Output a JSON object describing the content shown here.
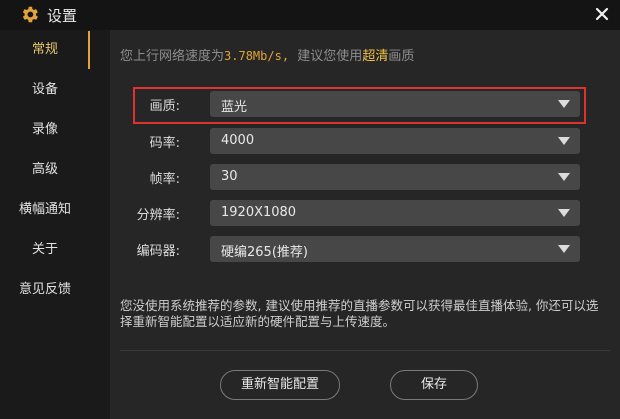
{
  "window": {
    "title": "设置",
    "title_icon": "gear-icon",
    "close_icon": "close-icon"
  },
  "sidebar": {
    "items": [
      {
        "label": "常规"
      },
      {
        "label": "设备"
      },
      {
        "label": "录像"
      },
      {
        "label": "高级"
      },
      {
        "label": "横幅通知"
      },
      {
        "label": "关于"
      },
      {
        "label": "意见反馈"
      }
    ],
    "active_index": 0
  },
  "tip": {
    "prefix": "您上行网络速度为",
    "speed": "3.78Mb/s,",
    "middle": "  建议您使用",
    "highlight": "超清",
    "suffix": "画质"
  },
  "settings": [
    {
      "label": "画质:",
      "value": "蓝光"
    },
    {
      "label": "码率:",
      "value": "4000"
    },
    {
      "label": "帧率:",
      "value": "30"
    },
    {
      "label": "分辨率:",
      "value": "1920X1080"
    },
    {
      "label": "编码器:",
      "value": "硬编265(推荐)"
    }
  ],
  "hint": "您没使用系统推荐的参数, 建议使用推荐的直播参数可以获得最佳直播体验, 你还可以选择重新智能配置以适应新的硬件配置与上传速度。",
  "buttons": {
    "reconfigure": "重新智能配置",
    "save": "保存"
  },
  "colors": {
    "accent": "#e0a43a",
    "highlight_text": "#f0c040",
    "selection_border": "#e0322c",
    "select_bg": "#474747"
  }
}
